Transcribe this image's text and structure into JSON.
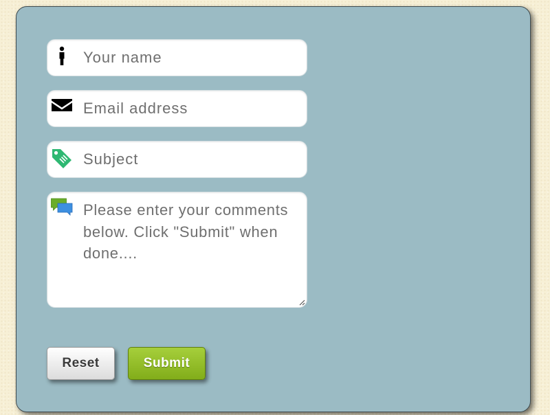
{
  "form": {
    "name": {
      "placeholder": "Your name",
      "icon": "person-icon"
    },
    "email": {
      "placeholder": "Email address",
      "icon": "envelope-icon"
    },
    "subject": {
      "placeholder": "Subject",
      "icon": "tag-icon"
    },
    "comments": {
      "placeholder": "Please enter your comments below.  Click \"Submit\" when done....",
      "icon": "speech-bubbles-icon"
    }
  },
  "buttons": {
    "reset_label": "Reset",
    "submit_label": "Submit"
  },
  "colors": {
    "page_background": "#f7f0d6",
    "panel_background": "#9bbbc4",
    "field_background": "#ffffff",
    "placeholder_text": "#6f6f6f",
    "submit_button": "#93bd2a",
    "reset_button": "#eeeeee",
    "tag_icon": "#2eb872",
    "bubble_green": "#6aad2a",
    "bubble_blue": "#3d8fe0"
  }
}
